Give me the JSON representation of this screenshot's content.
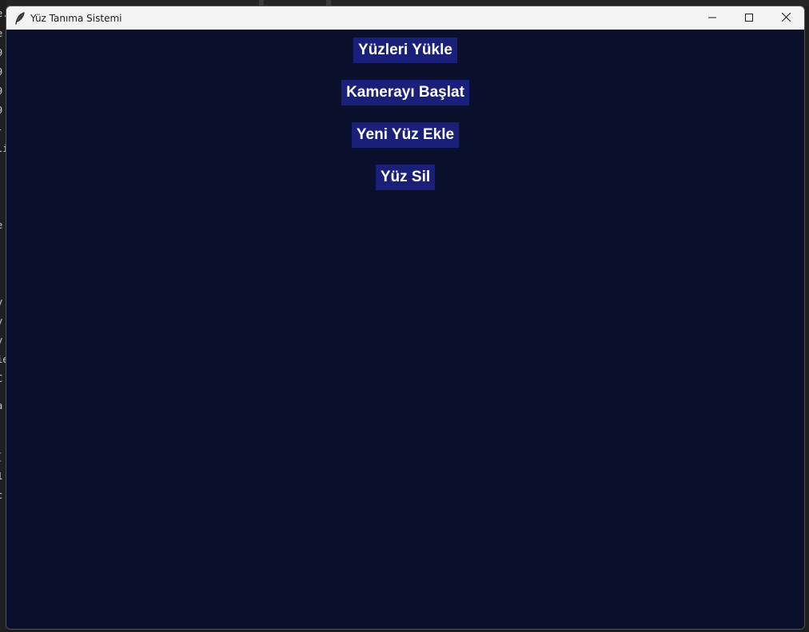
{
  "window": {
    "title": "Yüz Tanıma Sistemi"
  },
  "buttons": {
    "load_faces": "Yüzleri Yükle",
    "start_camera": "Kamerayı Başlat",
    "add_face": "Yeni Yüz Ekle",
    "delete_face": "Yüz Sil"
  },
  "background_editor_fragments": [
    "e.",
    "e",
    "9",
    "9",
    "9",
    "9",
    "-",
    "li",
    "e",
    "y",
    "y",
    "y",
    "ie",
    "C",
    "a",
    "[",
    "1",
    "c"
  ],
  "colors": {
    "window_background": "#0a0f2b",
    "button_background": "#1a1f7a",
    "button_text": "#ffffff",
    "titlebar": "#f3f3f3"
  },
  "icons": {
    "app": "feather-icon",
    "minimize": "minimize-icon",
    "maximize": "maximize-icon",
    "close": "close-icon"
  }
}
